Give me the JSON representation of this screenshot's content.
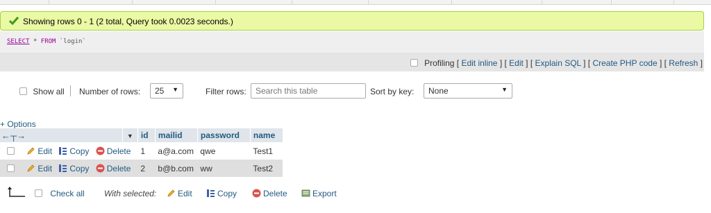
{
  "status": {
    "message": "Showing rows 0 - 1 (2 total, Query took 0.0023 seconds.)"
  },
  "sql": {
    "select_kw": "SELECT",
    "star": "*",
    "from_kw": "FROM",
    "table": "`login`"
  },
  "query_links": {
    "profiling": "Profiling",
    "edit_inline": "Edit inline",
    "edit": "Edit",
    "explain": "Explain SQL",
    "create_php": "Create PHP code",
    "refresh": "Refresh"
  },
  "nav": {
    "show_all": "Show all",
    "number_of_rows_label": "Number of rows:",
    "number_of_rows_value": "25",
    "filter_label": "Filter rows:",
    "filter_placeholder": "Search this table",
    "sort_label": "Sort by key:",
    "sort_value": "None"
  },
  "table": {
    "options_link": "+ Options",
    "columns": [
      "id",
      "mailid",
      "password",
      "name"
    ],
    "action_labels": {
      "edit": "Edit",
      "copy": "Copy",
      "delete": "Delete"
    },
    "rows": [
      {
        "id": "1",
        "mailid": "a@a.com",
        "password": "qwe",
        "name": "Test1"
      },
      {
        "id": "2",
        "mailid": "b@b.com",
        "password": "ww",
        "name": "Test2"
      }
    ]
  },
  "bulk": {
    "check_all": "Check all",
    "with_selected": "With selected:",
    "edit": "Edit",
    "copy": "Copy",
    "delete": "Delete",
    "export": "Export"
  },
  "colors": {
    "success_bg": "#ebf8a4",
    "link": "#235a81",
    "header_bg": "#dfe5ea",
    "delete_red": "#d9534f"
  }
}
